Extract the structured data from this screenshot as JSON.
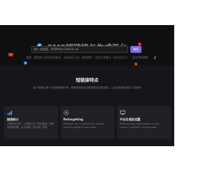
{
  "hero": {
    "title": "SMS短链接与生成平台",
    "subtitle": "缩短、跟踪和分享您的短链接，支持地区分流、随机跳转、回定分流路径（支持自定义）、监控到期提醒",
    "url_placeholder": "输入长链接，例如https://baidu.io/",
    "shorten_label": "缩短",
    "social_icons": [
      "twitter-icon",
      "youtube-icon",
      "facebook-icon",
      "pinterest-icon",
      "tiktok-icon",
      "reddit-icon"
    ]
  },
  "features": {
    "title": "短链接特点",
    "description": "缩小的网址便于在各种渠道分享，跟踪链接的点击数据和访问者信息，让您对链接的表现了如指掌",
    "cards": [
      {
        "icon": "chart-icon",
        "title": "链接统计",
        "description": "了解谁在何时，从哪里点击了您的链接，帮助您获取洞察，优化营销，提升推广效果"
      },
      {
        "icon": "retarget-icon",
        "title": "Retargeting",
        "description": "Retarget your audience by adding tracking pixels to your links."
      },
      {
        "icon": "platform-icon",
        "title": "平台及语言设置",
        "description": "Redirect your users based on the country, platform, or language."
      }
    ]
  },
  "colors": {
    "accent": "#7c6ae0",
    "hero_bg": "#0f0f10",
    "section_bg": "#16161a",
    "card_bg": "#202025"
  }
}
